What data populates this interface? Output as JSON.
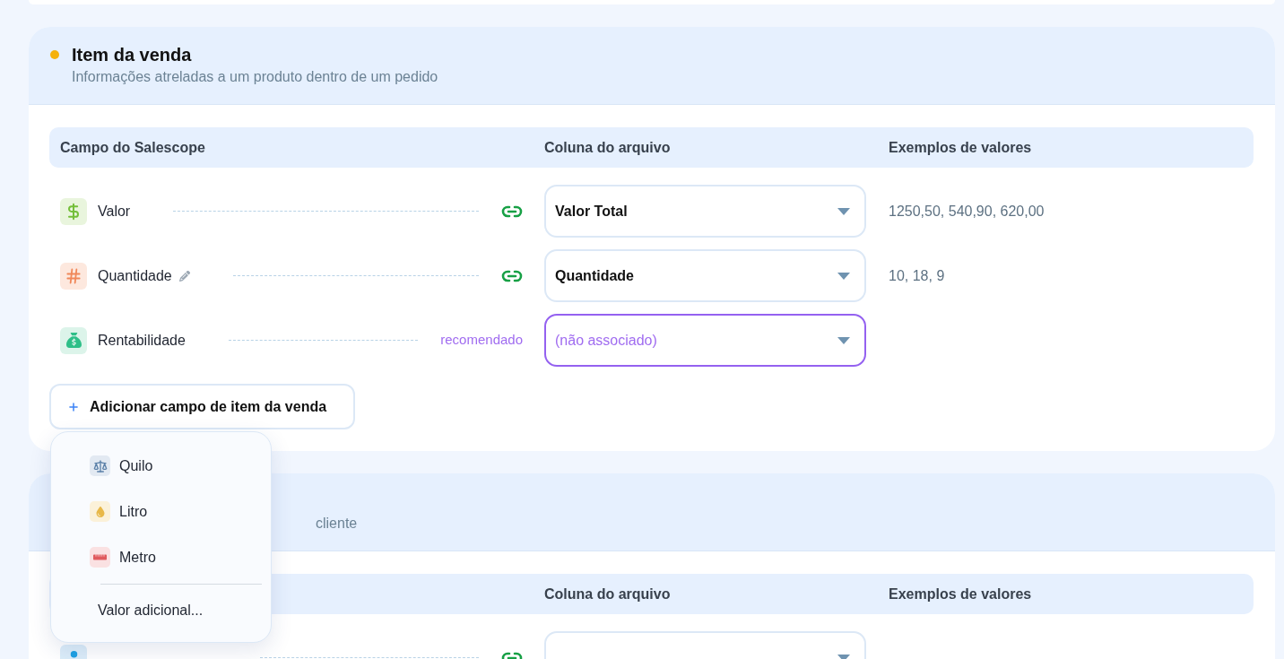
{
  "sections": [
    {
      "title": "Item da venda",
      "subtitle": "Informações atreladas a um produto dentro de um pedido",
      "color": "#f5b10c",
      "columns": {
        "field": "Campo do Salescope",
        "file_column": "Coluna do arquivo",
        "examples": "Exemplos de valores"
      },
      "fields": [
        {
          "kind": "currency",
          "label": "Valor",
          "editable": false,
          "linked": true,
          "column": {
            "value": "Valor Total"
          },
          "examples": "1250,50, 540,90, 620,00"
        },
        {
          "kind": "number",
          "label": "Quantidade",
          "editable": true,
          "linked": true,
          "column": {
            "value": "Quantidade"
          },
          "examples": "10, 18, 9"
        },
        {
          "kind": "profit",
          "label": "Rentabilidade",
          "editable": false,
          "linked": false,
          "hint": "recomendado",
          "column": {
            "placeholder": "(não associado)"
          }
        }
      ],
      "add_button": {
        "label": "Adicionar campo de item da venda",
        "expanded": true
      },
      "add_menu": {
        "items": [
          {
            "kind": "weight",
            "label": "Quilo"
          },
          {
            "kind": "volume",
            "label": "Litro"
          },
          {
            "kind": "length",
            "label": "Metro"
          }
        ],
        "footer": "Valor adicional..."
      }
    },
    {
      "subtitle": "cliente",
      "columns": {
        "file_column": "Coluna do arquivo",
        "examples": "Exemplos de valores"
      },
      "fields": [
        {
          "kind": "person",
          "linked": true
        }
      ]
    }
  ]
}
